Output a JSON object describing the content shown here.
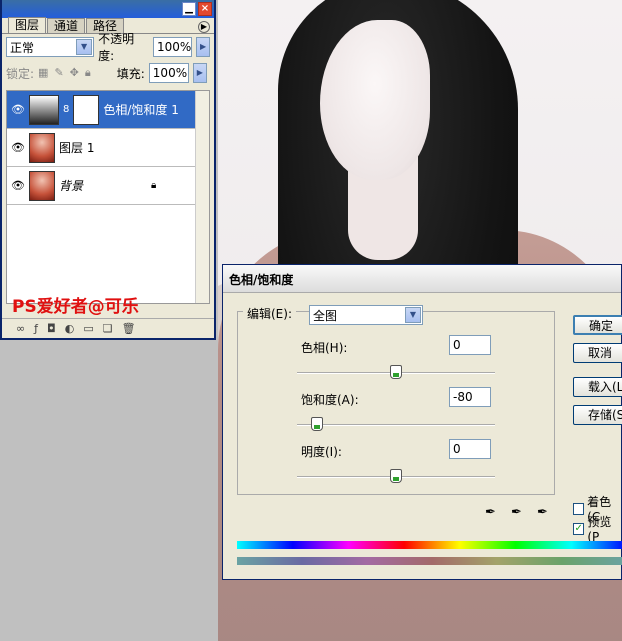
{
  "layers_panel": {
    "tabs": [
      "图层",
      "通道",
      "路径"
    ],
    "blend_mode": "正常",
    "opacity_label": "不透明度:",
    "opacity_value": "100%",
    "lock_label": "锁定:",
    "fill_label": "填充:",
    "fill_value": "100%",
    "layers": [
      {
        "name": "色相/饱和度 1",
        "selected": true
      },
      {
        "name": "图层 1",
        "selected": false
      },
      {
        "name": "背景",
        "selected": false
      }
    ],
    "watermark": "PS爱好者@可乐"
  },
  "dialog": {
    "title": "色相/饱和度",
    "edit_label": "编辑(E):",
    "edit_value": "全图",
    "hue_label": "色相(H):",
    "hue_value": "0",
    "hue_level": 0,
    "saturation_label": "饱和度(A):",
    "saturation_value": "-80",
    "saturation_level": -80,
    "lightness_label": "明度(I):",
    "lightness_value": "0",
    "lightness_level": 0,
    "ok_button": "确定",
    "cancel_button": "取消",
    "load_button": "载入(L",
    "save_button": "存储(S",
    "colorize_label": "着色(C",
    "colorize_checked": false,
    "preview_label": "预览(P",
    "preview_checked": true
  }
}
